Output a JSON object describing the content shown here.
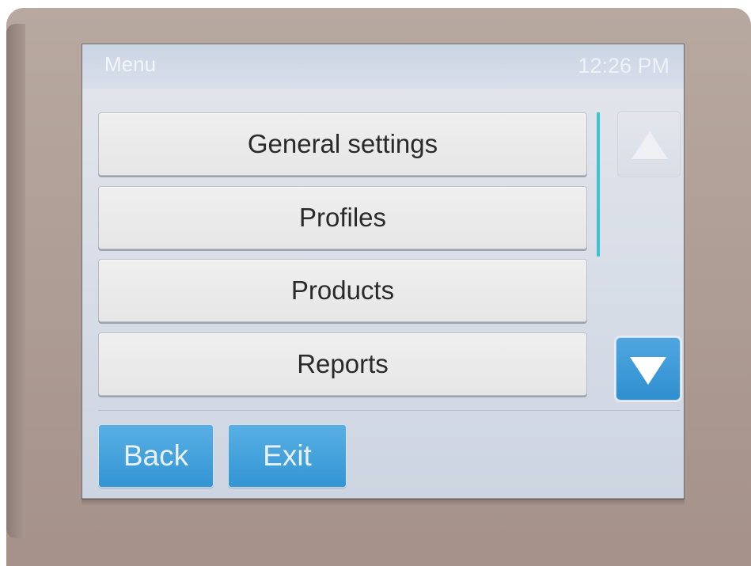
{
  "header": {
    "title": "Menu",
    "time": "12:26 PM"
  },
  "menu": {
    "items": [
      {
        "label": "General settings"
      },
      {
        "label": "Profiles"
      },
      {
        "label": "Products"
      },
      {
        "label": "Reports"
      }
    ]
  },
  "navigation": {
    "back_label": "Back",
    "exit_label": "Exit"
  },
  "scroll": {
    "up_icon": "arrow-up-icon",
    "down_icon": "arrow-down-icon"
  },
  "colors": {
    "accent_blue": "#3e9edb",
    "scroll_indicator": "#3fc3d3"
  }
}
